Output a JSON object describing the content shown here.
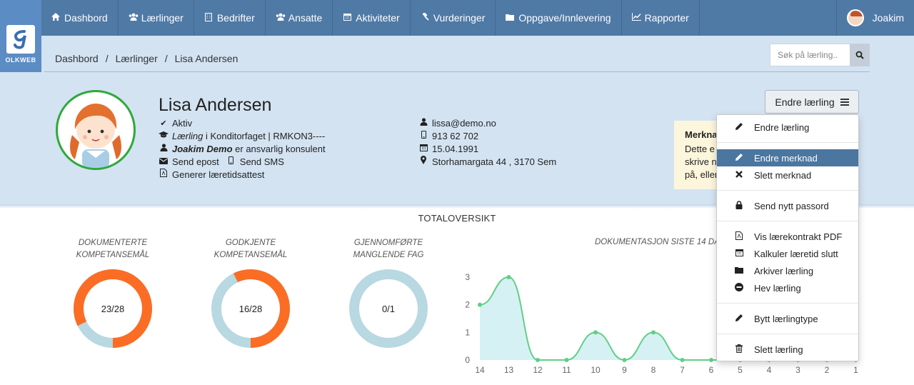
{
  "nav": {
    "items": [
      {
        "label": "Dashbord",
        "icon": "home-icon"
      },
      {
        "label": "Lærlinger",
        "icon": "users-icon"
      },
      {
        "label": "Bedrifter",
        "icon": "building-icon"
      },
      {
        "label": "Ansatte",
        "icon": "users-icon"
      },
      {
        "label": "Aktiviteter",
        "icon": "calendar-icon"
      },
      {
        "label": "Vurderinger",
        "icon": "gavel-icon"
      },
      {
        "label": "Oppgave/Innlevering",
        "icon": "folder-icon"
      },
      {
        "label": "Rapporter",
        "icon": "line-chart-icon"
      }
    ],
    "user_name": "Joakim",
    "logo_text": "OLKWEB"
  },
  "breadcrumb": {
    "items": [
      "Dashbord",
      "Lærlinger",
      "Lisa Andersen"
    ],
    "separator": "/"
  },
  "search": {
    "placeholder": "Søk på lærling.."
  },
  "profile": {
    "name": "Lisa Andersen",
    "status": "Aktiv",
    "role_prefix": "Lærling",
    "role_rest": " i Konditorfaget | RMKON3----",
    "consultant_name": "Joakim Demo",
    "consultant_rest": " er ansvarlig konsulent",
    "send_email": "Send epost",
    "send_sms": "Send SMS",
    "generate": "Generer læretidsattest",
    "email": "lissa@demo.no",
    "phone": "913 62 702",
    "birthdate": "15.04.1991",
    "address": "Storhamargata 44 , 3170 Sem"
  },
  "note": {
    "title": "Merkna",
    "text_lines": [
      "Dette e",
      "skrive n",
      "på, eller"
    ]
  },
  "edit_button": {
    "label": "Endre lærling"
  },
  "menu": {
    "groups": [
      [
        {
          "label": "Endre lærling",
          "icon": "pencil-icon",
          "active": false
        }
      ],
      [
        {
          "label": "Endre merknad",
          "icon": "pencil-icon",
          "active": true
        },
        {
          "label": "Slett merknad",
          "icon": "times-icon",
          "active": false
        }
      ],
      [
        {
          "label": "Send nytt passord",
          "icon": "lock-icon",
          "active": false
        }
      ],
      [
        {
          "label": "Vis lærekontrakt PDF",
          "icon": "file-pdf-icon",
          "active": false
        },
        {
          "label": "Kalkuler læretid slutt",
          "icon": "calendar-icon",
          "active": false
        },
        {
          "label": "Arkiver lærling",
          "icon": "folder-icon",
          "active": false
        },
        {
          "label": "Hev lærling",
          "icon": "minus-circle-icon",
          "active": false
        }
      ],
      [
        {
          "label": "Bytt lærlingtype",
          "icon": "pencil-icon",
          "active": false
        }
      ],
      [
        {
          "label": "Slett lærling",
          "icon": "trash-icon",
          "active": false
        }
      ]
    ],
    "active_color": "#4a76a0"
  },
  "stats": {
    "title": "TOTALOVERSIKT",
    "donuts": [
      {
        "title_lines": [
          "DOKUMENTERTE",
          "KOMPETANSEMÅL"
        ],
        "label": "23/28",
        "done": 23,
        "total": 28
      },
      {
        "title_lines": [
          "GODKJENTE",
          "KOMPETANSEMÅL"
        ],
        "label": "16/28",
        "done": 16,
        "total": 28
      },
      {
        "title_lines": [
          "GJENNOMFØRTE",
          "MANGLENDE FAG"
        ],
        "label": "0/1",
        "done": 0,
        "total": 1
      }
    ],
    "colors": {
      "done": "#fb6d24",
      "rest": "#b8d8e2"
    },
    "chart_title": "DOKUMENTASJON SISTE 14 DA"
  },
  "chart_data": {
    "type": "area",
    "title": "DOKUMENTASJON SISTE 14 DA",
    "x": [
      "14",
      "13",
      "12",
      "11",
      "10",
      "9",
      "8",
      "7",
      "6",
      "5",
      "4",
      "3",
      "2",
      "1"
    ],
    "series": [
      {
        "values": [
          2,
          3,
          0,
          0,
          1,
          0,
          1,
          0,
          0,
          0,
          0,
          0,
          0,
          0
        ]
      }
    ],
    "yticks": [
      0,
      1,
      2,
      3
    ],
    "ylim": [
      0,
      3
    ],
    "grid": false,
    "line_color": "#5fcf87",
    "fill_color": "#d6f1f3"
  }
}
